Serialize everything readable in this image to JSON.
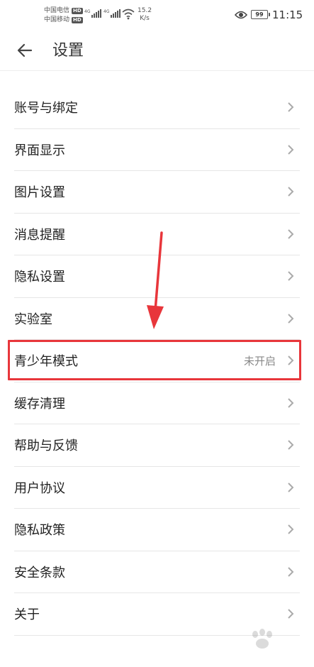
{
  "status_bar": {
    "carrier_1": "中国电信",
    "carrier_2": "中国移动",
    "hd_badge": "HD",
    "network_label": "4G",
    "speed_value": "15.2",
    "speed_unit": "K/s",
    "battery_level": "99",
    "time": "11:15"
  },
  "header": {
    "title": "设置"
  },
  "settings": {
    "items": [
      {
        "label": "账号与绑定",
        "value": ""
      },
      {
        "label": "界面显示",
        "value": ""
      },
      {
        "label": "图片设置",
        "value": ""
      },
      {
        "label": "消息提醒",
        "value": ""
      },
      {
        "label": "隐私设置",
        "value": ""
      },
      {
        "label": "实验室",
        "value": ""
      },
      {
        "label": "青少年模式",
        "value": "未开启"
      },
      {
        "label": "缓存清理",
        "value": ""
      },
      {
        "label": "帮助与反馈",
        "value": ""
      },
      {
        "label": "用户协议",
        "value": ""
      },
      {
        "label": "隐私政策",
        "value": ""
      },
      {
        "label": "安全条款",
        "value": ""
      },
      {
        "label": "关于",
        "value": ""
      }
    ]
  },
  "annotation": {
    "color": "#e8363b"
  }
}
